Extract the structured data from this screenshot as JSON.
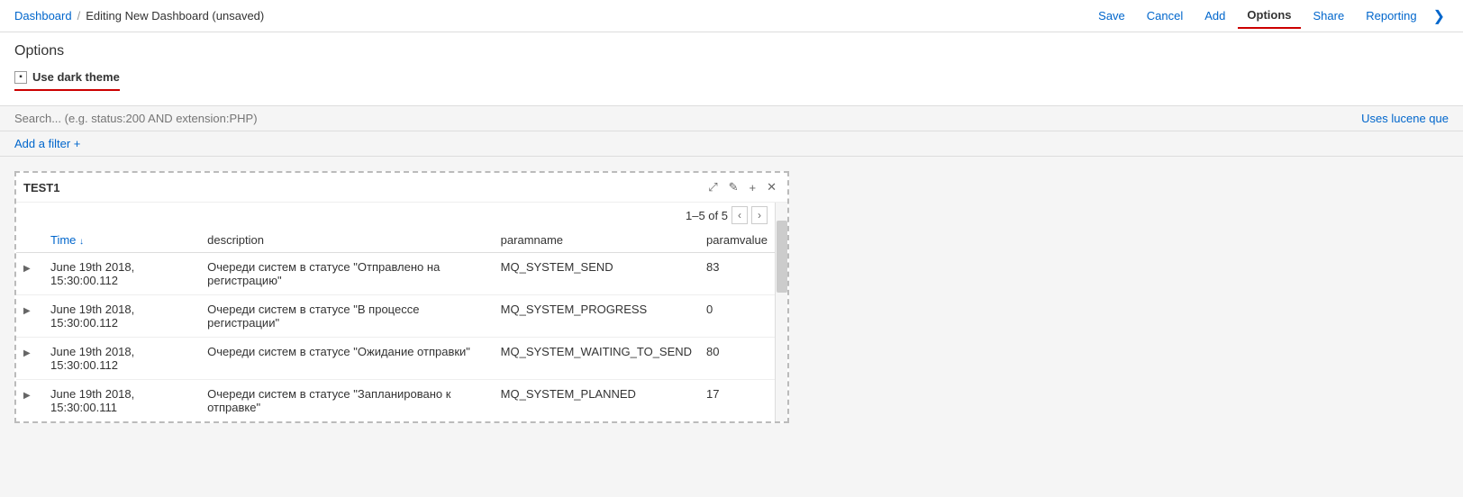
{
  "topbar": {
    "breadcrumb_home": "Dashboard",
    "separator": "/",
    "breadcrumb_current": "Editing New Dashboard (unsaved)",
    "actions": [
      {
        "id": "save",
        "label": "Save",
        "active": false
      },
      {
        "id": "cancel",
        "label": "Cancel",
        "active": false
      },
      {
        "id": "add",
        "label": "Add",
        "active": false
      },
      {
        "id": "options",
        "label": "Options",
        "active": true
      },
      {
        "id": "share",
        "label": "Share",
        "active": false
      },
      {
        "id": "reporting",
        "label": "Reporting",
        "active": false
      }
    ],
    "chevron_label": "❯"
  },
  "options": {
    "title": "Options",
    "dark_theme_label": "Use dark theme"
  },
  "search": {
    "placeholder": "Search... (e.g. status:200 AND extension:PHP)",
    "lucene_link": "Uses lucene que"
  },
  "filter": {
    "add_filter_label": "Add a filter +"
  },
  "widget": {
    "title": "TEST1",
    "pagination": "1–5 of 5",
    "columns": [
      {
        "id": "time",
        "label": "Time",
        "sortable": true,
        "sort_arrow": "↓"
      },
      {
        "id": "description",
        "label": "description",
        "sortable": false
      },
      {
        "id": "paramname",
        "label": "paramname",
        "sortable": false
      },
      {
        "id": "paramvalue",
        "label": "paramvalue",
        "sortable": false
      }
    ],
    "rows": [
      {
        "time": "June 19th 2018, 15:30:00.112",
        "description": "Очереди систем в статусе \"Отправлено на регистрацию\"",
        "paramname": "MQ_SYSTEM_SEND",
        "paramvalue": "83"
      },
      {
        "time": "June 19th 2018, 15:30:00.112",
        "description": "Очереди систем в статусе \"В процессе регистрации\"",
        "paramname": "MQ_SYSTEM_PROGRESS",
        "paramvalue": "0"
      },
      {
        "time": "June 19th 2018, 15:30:00.112",
        "description": "Очереди систем в статусе \"Ожидание отправки\"",
        "paramname": "MQ_SYSTEM_WAITING_TO_SEND",
        "paramvalue": "80"
      },
      {
        "time": "June 19th 2018, 15:30:00.111",
        "description": "Очереди систем в статусе \"Запланировано к отправке\"",
        "paramname": "MQ_SYSTEM_PLANNED",
        "paramvalue": "17"
      }
    ],
    "actions": {
      "expand_icon": "⤢",
      "edit_icon": "✎",
      "add_icon": "+",
      "close_icon": "✕"
    }
  },
  "colors": {
    "accent": "#cc0000",
    "link": "#0066cc"
  }
}
